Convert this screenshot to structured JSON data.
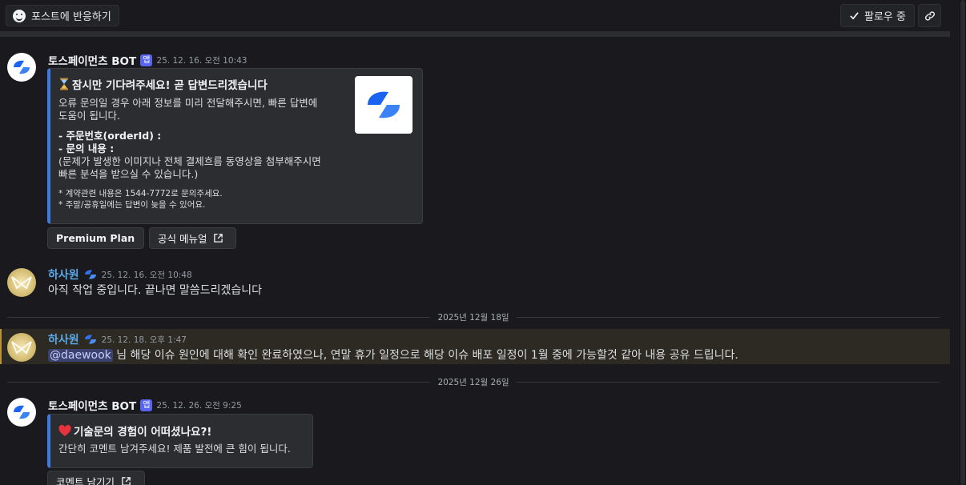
{
  "topbar": {
    "react_label": "포스트에 반응하기",
    "follow_label": "팔로우 중",
    "icons": {
      "react": "smile-icon",
      "follow": "check-icon",
      "link": "link-icon"
    }
  },
  "messages": [
    {
      "author": "토스페이먼츠 BOT",
      "badge": "앱",
      "timestamp": "25. 12. 16. 오전 10:43",
      "embed": {
        "title_icon": "hourglass-icon",
        "title": "잠시만 기다려주세요! 곧 답변드리겠습니다",
        "desc_line1": "오류 문의일 경우 아래 정보를 미리 전달해주시면, 빠른 답변에",
        "desc_line2": "도움이 됩니다.",
        "field_order": "- 주문번호(orderId) :",
        "field_inquiry": "- 문의 내용 :",
        "note_line1": "(문제가 발생한 이미지나 전체 결제흐름 동영상을 첨부해주시면",
        "note_line2": "빠른 분석을 받으실 수 있습니다.)",
        "small1": "* 계약관련 내용은 1544-7772로 문의주세요.",
        "small2": "* 주말/공휴일에는 답변이 늦을 수 있어요."
      },
      "buttons": [
        "Premium Plan",
        "공식 메뉴얼"
      ]
    },
    {
      "author": "하사원",
      "timestamp": "25. 12. 16. 오전 10:48",
      "text": "아직 작업 중입니다. 끝나면 말씀드리겠습니다"
    },
    {
      "date_separator": "2025년 12월 18일"
    },
    {
      "author": "하사원",
      "timestamp": "25. 12. 18. 오후 1:47",
      "mention": "@daewook",
      "text": " 님 해당 이슈 원인에 대해 확인 완료하였으나, 연말 휴가 일정으로 해당 이슈 배포 일정이 1월 중에 가능할것 같아 내용 공유 드립니다."
    },
    {
      "date_separator": "2025년 12월 26일"
    },
    {
      "author": "토스페이먼츠 BOT",
      "badge": "앱",
      "timestamp": "25. 12. 26. 오전 9:25",
      "embed": {
        "title_icon": "heart-icon",
        "title": "기술문의 경험이 어떠셨나요?!",
        "desc": "간단히 코멘트 남겨주세요! 제품 발전에 큰 힘이 됩니다."
      },
      "buttons": [
        "코멘트 남기기"
      ]
    }
  ],
  "colors": {
    "accent": "#3d7be0",
    "badge": "#5865f2",
    "user_name": "#5aa9ea",
    "highlight": "#2c2a22"
  }
}
